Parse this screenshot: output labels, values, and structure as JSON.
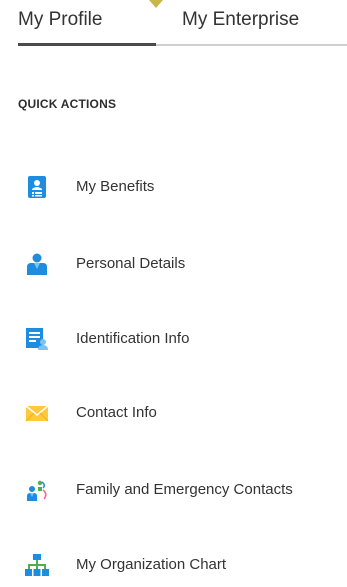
{
  "tabs": [
    {
      "label": "My Profile",
      "selected": true
    },
    {
      "label": "My Enterprise",
      "selected": false
    }
  ],
  "quick_actions": {
    "title": "QUICK ACTIONS",
    "items": [
      {
        "label": "My Benefits",
        "icon": "id-badge-icon"
      },
      {
        "label": "Personal Details",
        "icon": "person-icon"
      },
      {
        "label": "Identification Info",
        "icon": "document-id-icon"
      },
      {
        "label": "Contact Info",
        "icon": "envelope-icon"
      },
      {
        "label": "Family and Emergency Contacts",
        "icon": "family-icon"
      },
      {
        "label": "My Organization Chart",
        "icon": "org-chart-icon"
      }
    ]
  },
  "colors": {
    "icon_blue": "#1e8de0",
    "icon_light_blue": "#7cc3f5",
    "envelope_yellow": "#ffc83d",
    "family_green": "#4caf50",
    "family_pink": "#ec6b9a",
    "tab_accent": "#c9b64a"
  }
}
